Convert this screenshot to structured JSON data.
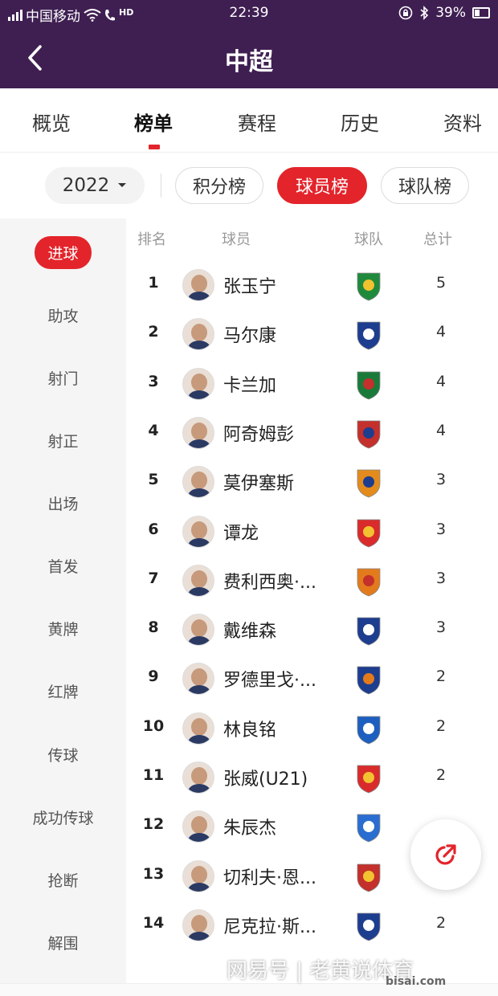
{
  "status_bar": {
    "carrier": "中国移动",
    "hd": "HD",
    "time": "22:39",
    "battery": "39%"
  },
  "header": {
    "title": "中超"
  },
  "tabs": [
    {
      "label": "概览"
    },
    {
      "label": "榜单"
    },
    {
      "label": "赛程"
    },
    {
      "label": "历史"
    },
    {
      "label": "资料"
    }
  ],
  "filters": {
    "year": "2022",
    "pills": [
      {
        "label": "积分榜"
      },
      {
        "label": "球员榜"
      },
      {
        "label": "球队榜"
      }
    ]
  },
  "sidebar": {
    "items": [
      {
        "label": "进球"
      },
      {
        "label": "助攻"
      },
      {
        "label": "射门"
      },
      {
        "label": "射正"
      },
      {
        "label": "出场"
      },
      {
        "label": "首发"
      },
      {
        "label": "黄牌"
      },
      {
        "label": "红牌"
      },
      {
        "label": "传球"
      },
      {
        "label": "成功传球"
      },
      {
        "label": "抢断"
      },
      {
        "label": "解围"
      }
    ]
  },
  "table": {
    "headers": {
      "rank": "排名",
      "player": "球员",
      "team": "球队",
      "total": "总计"
    },
    "rows": [
      {
        "rank": "1",
        "player": "张玉宁",
        "total": "5"
      },
      {
        "rank": "2",
        "player": "马尔康",
        "total": "4"
      },
      {
        "rank": "3",
        "player": "卡兰加",
        "total": "4"
      },
      {
        "rank": "4",
        "player": "阿奇姆彭",
        "total": "4"
      },
      {
        "rank": "5",
        "player": "莫伊塞斯",
        "total": "3"
      },
      {
        "rank": "6",
        "player": "谭龙",
        "total": "3"
      },
      {
        "rank": "7",
        "player": "费利西奥·...",
        "total": "3"
      },
      {
        "rank": "8",
        "player": "戴维森",
        "total": "3"
      },
      {
        "rank": "9",
        "player": "罗德里戈·...",
        "total": "2"
      },
      {
        "rank": "10",
        "player": "林良铭",
        "total": "2"
      },
      {
        "rank": "11",
        "player": "张威(U21)",
        "total": "2"
      },
      {
        "rank": "12",
        "player": "朱辰杰",
        "total": ""
      },
      {
        "rank": "13",
        "player": "切利夫·恩...",
        "total": ""
      },
      {
        "rank": "14",
        "player": "尼克拉·斯...",
        "total": "2"
      }
    ]
  },
  "watermark": {
    "text": "网易号 | 老黄说体育",
    "site": "bisai.com"
  },
  "colors": {
    "header_bg": "#3f1f52",
    "accent": "#e3242b",
    "sidebar_bg": "#f5f5f5"
  }
}
